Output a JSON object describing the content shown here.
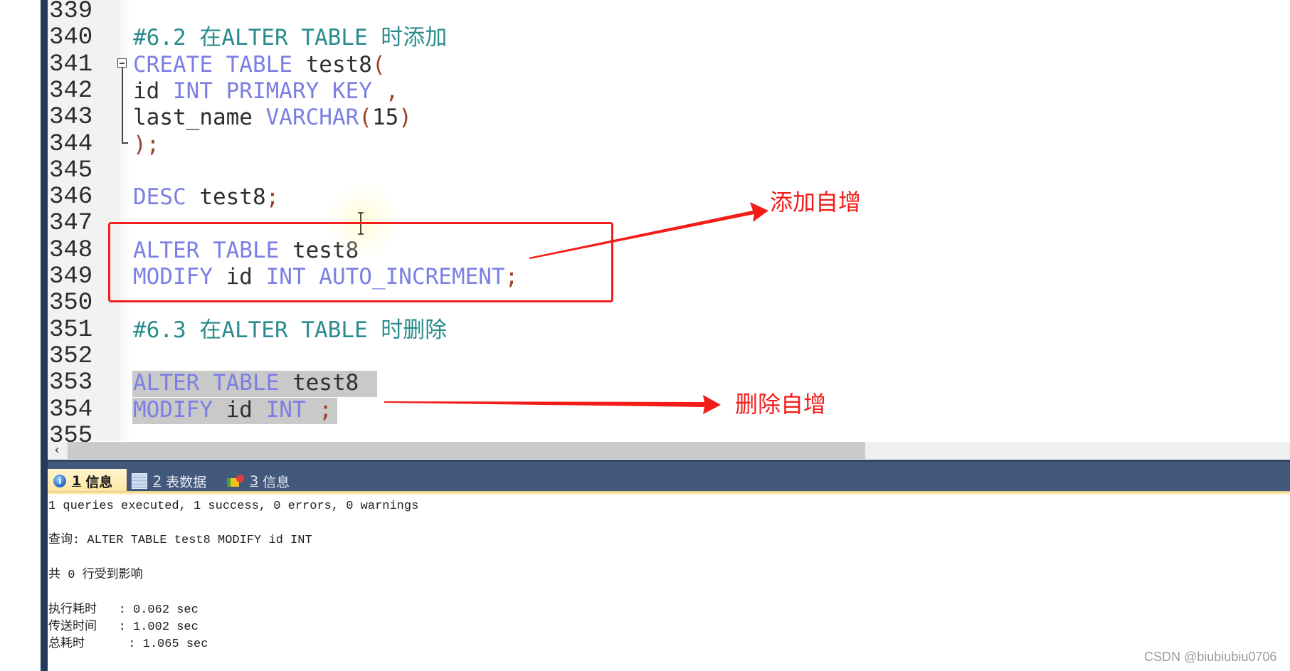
{
  "editor": {
    "lines": [
      {
        "no": "339",
        "tokens": []
      },
      {
        "no": "340",
        "tokens": [
          {
            "t": "#6.2 在ALTER TABLE 时添加",
            "c": "comment"
          }
        ]
      },
      {
        "no": "341",
        "tokens": [
          {
            "t": "CREATE TABLE",
            "c": "kw"
          },
          {
            "t": " test8",
            "c": "id"
          },
          {
            "t": "(",
            "c": "punc"
          }
        ]
      },
      {
        "no": "342",
        "tokens": [
          {
            "t": "id",
            "c": "id"
          },
          {
            "t": " INT PRIMARY KEY",
            "c": "kw"
          },
          {
            "t": " ,",
            "c": "punc"
          }
        ]
      },
      {
        "no": "343",
        "tokens": [
          {
            "t": "last_name",
            "c": "id"
          },
          {
            "t": " VARCHAR",
            "c": "kw"
          },
          {
            "t": "(",
            "c": "punc"
          },
          {
            "t": "15",
            "c": "id"
          },
          {
            "t": ")",
            "c": "punc"
          }
        ]
      },
      {
        "no": "344",
        "tokens": [
          {
            "t": ");",
            "c": "punc"
          }
        ]
      },
      {
        "no": "345",
        "tokens": []
      },
      {
        "no": "346",
        "tokens": [
          {
            "t": "DESC",
            "c": "kw"
          },
          {
            "t": " test8",
            "c": "id"
          },
          {
            "t": ";",
            "c": "punc"
          }
        ]
      },
      {
        "no": "347",
        "tokens": []
      },
      {
        "no": "348",
        "tokens": [
          {
            "t": "ALTER TABLE",
            "c": "kw"
          },
          {
            "t": " test8",
            "c": "id"
          }
        ]
      },
      {
        "no": "349",
        "tokens": [
          {
            "t": "MODIFY",
            "c": "kw"
          },
          {
            "t": " id",
            "c": "id"
          },
          {
            "t": " INT AUTO_INCREMENT",
            "c": "kw"
          },
          {
            "t": ";",
            "c": "punc"
          }
        ]
      },
      {
        "no": "350",
        "tokens": []
      },
      {
        "no": "351",
        "tokens": [
          {
            "t": "#6.3 在ALTER TABLE 时删除",
            "c": "comment"
          }
        ]
      },
      {
        "no": "352",
        "tokens": []
      },
      {
        "no": "353",
        "tokens": [
          {
            "t": "ALTER TABLE",
            "c": "kw"
          },
          {
            "t": " test8",
            "c": "id"
          },
          {
            "t": " ",
            "c": "id"
          }
        ],
        "selected": true
      },
      {
        "no": "354",
        "tokens": [
          {
            "t": "MODIFY",
            "c": "kw"
          },
          {
            "t": " id",
            "c": "id"
          },
          {
            "t": " INT",
            "c": "kw"
          },
          {
            "t": " ;",
            "c": "punc"
          }
        ],
        "selected": true
      },
      {
        "no": "355",
        "tokens": []
      }
    ],
    "scroll_left_glyph": "‹"
  },
  "result_tabs": [
    {
      "num": "1",
      "label": "信息",
      "icon": "info-icon",
      "active": true
    },
    {
      "num": "2",
      "label": "表数据",
      "icon": "table-grid-icon",
      "active": false
    },
    {
      "num": "3",
      "label": "信息",
      "icon": "messages-icon",
      "active": false
    }
  ],
  "output": {
    "summary": "1 queries executed, 1 success, 0 errors, 0 warnings",
    "query": "查询: ALTER TABLE test8 MODIFY id INT",
    "affected": "共 0 行受到影响",
    "timings": [
      "执行耗时   : 0.062 sec",
      "传送时间   : 1.002 sec",
      "总耗时      : 1.065 sec"
    ]
  },
  "annotations": {
    "add_auto_increment": "添加自增",
    "remove_auto_increment": "删除自增",
    "color": "#f21d19"
  },
  "watermark": "CSDN @biubiubiu0706"
}
